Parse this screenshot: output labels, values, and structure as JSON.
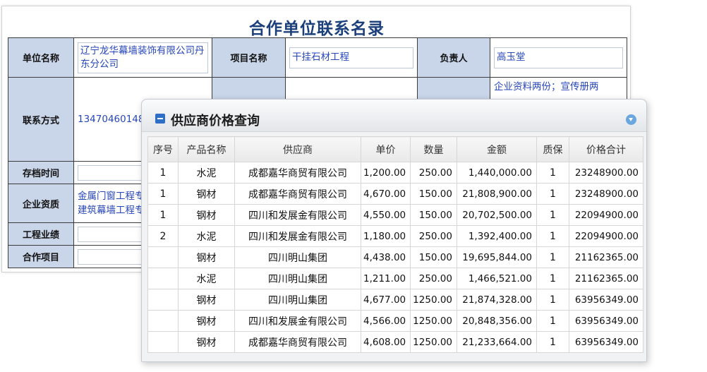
{
  "form": {
    "title": "合作单位联系名录",
    "unit_name_label": "单位名称",
    "unit_name_value": "辽宁龙华幕墙装饰有限公司丹东分公司",
    "project_name_label": "项目名称",
    "project_name_value": "干挂石材工程",
    "manager_label": "负责人",
    "manager_value": "高玉堂",
    "contact_label": "联系方式",
    "contact_value": "13470460148",
    "remark_value": "企业资料两份；宣传册两",
    "archive_time_label": "存档时间",
    "qualification_label": "企业资质",
    "qualification_line1": "金属门窗工程专",
    "qualification_line2": "建筑幕墙工程专",
    "performance_label": "工程业绩",
    "cooperation_label": "合作项目"
  },
  "panel": {
    "title": "供应商价格查询"
  },
  "table": {
    "columns": [
      "序号",
      "产品名称",
      "供应商",
      "单价",
      "数量",
      "金额",
      "质保",
      "价格合计"
    ],
    "rows": [
      [
        "1",
        "水泥",
        "成都嘉华商贸有限公司",
        "1,200.00",
        "250.00",
        "1,440,000.00",
        "1",
        "23248900.00"
      ],
      [
        "1",
        "钢材",
        "成都嘉华商贸有限公司",
        "4,670.00",
        "150.00",
        "21,808,900.00",
        "1",
        "23248900.00"
      ],
      [
        "1",
        "钢材",
        "四川和发展金有限公司",
        "4,550.00",
        "150.00",
        "20,702,500.00",
        "1",
        "22094900.00"
      ],
      [
        "2",
        "水泥",
        "四川和发展金有限公司",
        "1,180.00",
        "250.00",
        "1,392,400.00",
        "1",
        "22094900.00"
      ],
      [
        "",
        "钢材",
        "四川明山集团",
        "4,438.00",
        "150.00",
        "19,695,844.00",
        "1",
        "21162365.00"
      ],
      [
        "",
        "水泥",
        "四川明山集团",
        "1,211.00",
        "250.00",
        "1,466,521.00",
        "1",
        "21162365.00"
      ],
      [
        "",
        "钢材",
        "四川明山集团",
        "4,677.00",
        "1250.00",
        "21,874,328.00",
        "1",
        "63956349.00"
      ],
      [
        "",
        "钢材",
        "四川和发展金有限公司",
        "4,566.00",
        "1250.00",
        "20,848,356.00",
        "1",
        "63956349.00"
      ],
      [
        "",
        "钢材",
        "成都嘉华商贸有限公司",
        "4,608.00",
        "1250.00",
        "21,233,664.00",
        "1",
        "63956349.00"
      ]
    ]
  },
  "colors": {
    "title_blue": "#1a3f7a",
    "label_bg": "#c9d5e8",
    "value_text": "#2746b8",
    "accent_button": "#2f6fc7"
  },
  "icons": {
    "collapse": "minus-icon",
    "expand": "chevron-down-icon"
  }
}
